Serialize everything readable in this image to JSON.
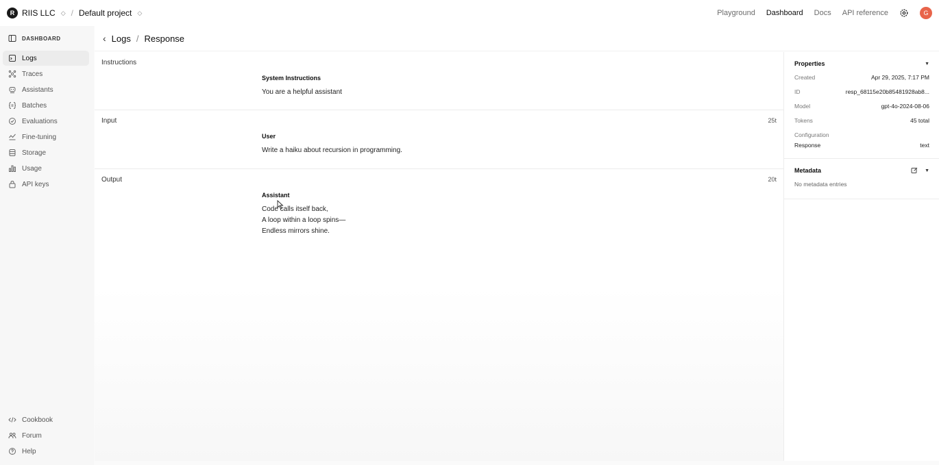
{
  "topbar": {
    "org_initial": "R",
    "org_name": "RIIS LLC",
    "project_name": "Default project",
    "nav": [
      "Playground",
      "Dashboard",
      "Docs",
      "API reference"
    ],
    "user_initial": "G",
    "user_color": "#e8644a"
  },
  "sidebar": {
    "heading": "DASHBOARD",
    "items": [
      {
        "label": "Logs",
        "icon": "logs-icon"
      },
      {
        "label": "Traces",
        "icon": "traces-icon"
      },
      {
        "label": "Assistants",
        "icon": "assistants-icon"
      },
      {
        "label": "Batches",
        "icon": "batches-icon"
      },
      {
        "label": "Evaluations",
        "icon": "evaluations-icon"
      },
      {
        "label": "Fine-tuning",
        "icon": "fine-tuning-icon"
      },
      {
        "label": "Storage",
        "icon": "storage-icon"
      },
      {
        "label": "Usage",
        "icon": "usage-icon"
      },
      {
        "label": "API keys",
        "icon": "api-keys-icon"
      }
    ],
    "bottom": [
      {
        "label": "Cookbook",
        "icon": "code-icon"
      },
      {
        "label": "Forum",
        "icon": "people-icon"
      },
      {
        "label": "Help",
        "icon": "help-icon"
      }
    ]
  },
  "breadcrumb": {
    "parent": "Logs",
    "current": "Response"
  },
  "sections": {
    "instructions": {
      "label": "Instructions",
      "role": "System Instructions",
      "text": "You are a helpful assistant"
    },
    "input": {
      "label": "Input",
      "count": "25t",
      "role": "User",
      "text": "Write a haiku about recursion in programming."
    },
    "output": {
      "label": "Output",
      "count": "20t",
      "role": "Assistant",
      "lines": [
        "Code calls itself back,",
        "A loop within a loop spins—",
        "Endless mirrors shine."
      ]
    }
  },
  "properties": {
    "heading": "Properties",
    "rows": [
      {
        "key": "Created",
        "value": "Apr 29, 2025, 7:17 PM"
      },
      {
        "key": "ID",
        "value": "resp_68115e20b85481928ab8..."
      },
      {
        "key": "Model",
        "value": "gpt-4o-2024-08-06"
      },
      {
        "key": "Tokens",
        "value": "45 total"
      }
    ],
    "config_label": "Configuration",
    "config_rows": [
      {
        "key": "Response",
        "value": "text"
      }
    ]
  },
  "metadata": {
    "heading": "Metadata",
    "empty": "No metadata entries"
  }
}
